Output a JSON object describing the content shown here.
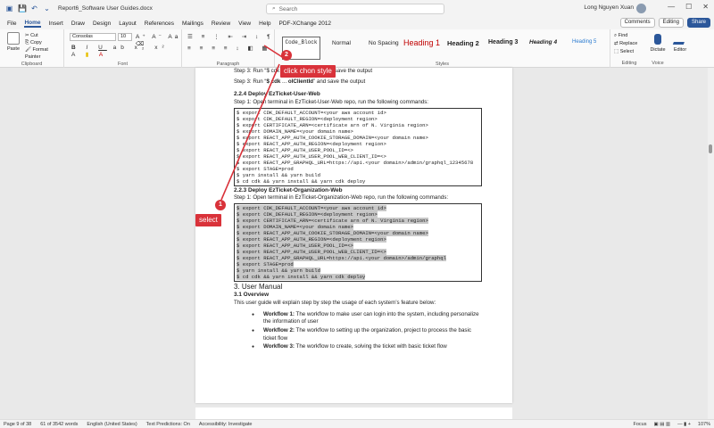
{
  "title": {
    "doc_name": "Report6_Software User Guides.docx",
    "search_placeholder": "Search",
    "user_name": "Long Nguyen Xuan"
  },
  "menu": [
    "File",
    "Home",
    "Insert",
    "Draw",
    "Design",
    "Layout",
    "References",
    "Mailings",
    "Review",
    "View",
    "Help",
    "PDF-XChange 2012"
  ],
  "menu_active": "Home",
  "top_buttons": {
    "comments": "Comments",
    "editing": "Editing",
    "share": "Share"
  },
  "ribbon": {
    "clipboard": {
      "paste": "Paste",
      "cut": "Cut",
      "copy": "Copy",
      "format_painter": "Format Painter",
      "label": "Clipboard"
    },
    "font": {
      "name": "Consolas",
      "size": "10",
      "label": "Font"
    },
    "paragraph_label": "Paragraph",
    "styles": {
      "items": [
        "Code_Block",
        "Normal",
        "No Spacing",
        "Heading 1",
        "Heading 2",
        "Heading 3",
        "Heading 4",
        "Heading 5"
      ],
      "label": "Styles"
    },
    "editing": {
      "find": "Find",
      "replace": "Replace",
      "select": "Select",
      "label": "Editing"
    },
    "voice": {
      "dictate": "Dictate",
      "label": "Voice"
    },
    "editor": {
      "label": "Editor"
    }
  },
  "document": {
    "step3a": "Step 3: Run “$ cdk ... deploy --build” and save the output",
    "step3b_prefix": "Step 3: Run “",
    "step3b_code": "$ cdk",
    "step3b_mid": " ... ",
    "step3b_code2": "olClientId",
    "step3b_suffix": "” and save the output",
    "h224": "2.2.4 Deploy EzTicket-User-Web",
    "step1_user": "Step 1: Open terminal in EzTicket-User-Web repo, run the following commands:",
    "code_user": [
      "$ export CDK_DEFAULT_ACCOUNT=<your aws account id>",
      "$ export CDK_DEFAULT_REGION=<deployment region>",
      "$ export CERTIFICATE_ARN=<certificate arn of N. Virginia region>",
      "$ export DOMAIN_NAME=<your domain name>",
      "$ export REACT_APP_AUTH_COOKIE_STORAGE_DOMAIN=<your domain name>",
      "$ export REACT_APP_AUTH_REGION=<deployment region>",
      "$ export REACT_APP_AUTH_USER_POOL_ID=<>",
      "$ export REACT_APP_AUTH_USER_POOL_WEB_CLIENT_ID=<>",
      "$ export REACT_APP_GRAPHQL_URL=https://api.<your domain>/admin/graphql_12345678",
      "$ export STAGE=prod",
      "$ yarn install && yarn build",
      "$ cd cdk && yarn install && yarn cdk deploy"
    ],
    "h223": "2.2.3 Deploy EzTicket-Organization-Web",
    "step1_org": "Step 1: Open terminal in EzTicket-Organization-Web repo, run the following commands:",
    "code_org": [
      "$ export CDK_DEFAULT_ACCOUNT=<your aws account id>",
      "$ export CDK_DEFAULT_REGION=<deployment region>",
      "$ export CERTIFICATE_ARN=<certificate arn of N. Virginia region>",
      "$ export DOMAIN_NAME=<your domain name>",
      "$ export REACT_APP_AUTH_COOKIE_STORAGE_DOMAIN=<your domain name>",
      "$ export REACT_APP_AUTH_REGION=<deployment region>",
      "$ export REACT_APP_AUTH_USER_POOL_ID=<>",
      "$ export REACT_APP_AUTH_USER_POOL_WEB_CLIENT_ID=<>",
      "$ export REACT_APP_GRAPHQL_URL=https://api.<your domain>/admin/graphql",
      "$ export STAGE=prod",
      "$ yarn install && yarn build",
      "$ cd cdk && yarn install && yarn cdk deploy"
    ],
    "h3": "3. User Manual",
    "h31": "3.1 Overview",
    "overview": "This user guide will explain step by step the usage of each system’s feature below:",
    "workflows": [
      {
        "name": "Workflow 1:",
        "text": " The workflow to make user can login into the system, including personalize the information of user"
      },
      {
        "name": "Workflow 2:",
        "text": " The workflow to setting up the organization, project to process the basic ticket flow"
      },
      {
        "name": "Workflow 3:",
        "text": " The workflow to create, solving the ticket with basic ticket flow"
      }
    ]
  },
  "annotations": {
    "n1": "1",
    "label1": "select",
    "n2": "2",
    "label2": "click chon style",
    "color": "#d9323a"
  },
  "status": {
    "page": "Page 9 of 38",
    "words": "61 of 3542 words",
    "lang": "English (United States)",
    "predictions": "Text Predictions: On",
    "accessibility": "Accessibility: Investigate",
    "focus": "Focus",
    "zoom": "107%"
  }
}
